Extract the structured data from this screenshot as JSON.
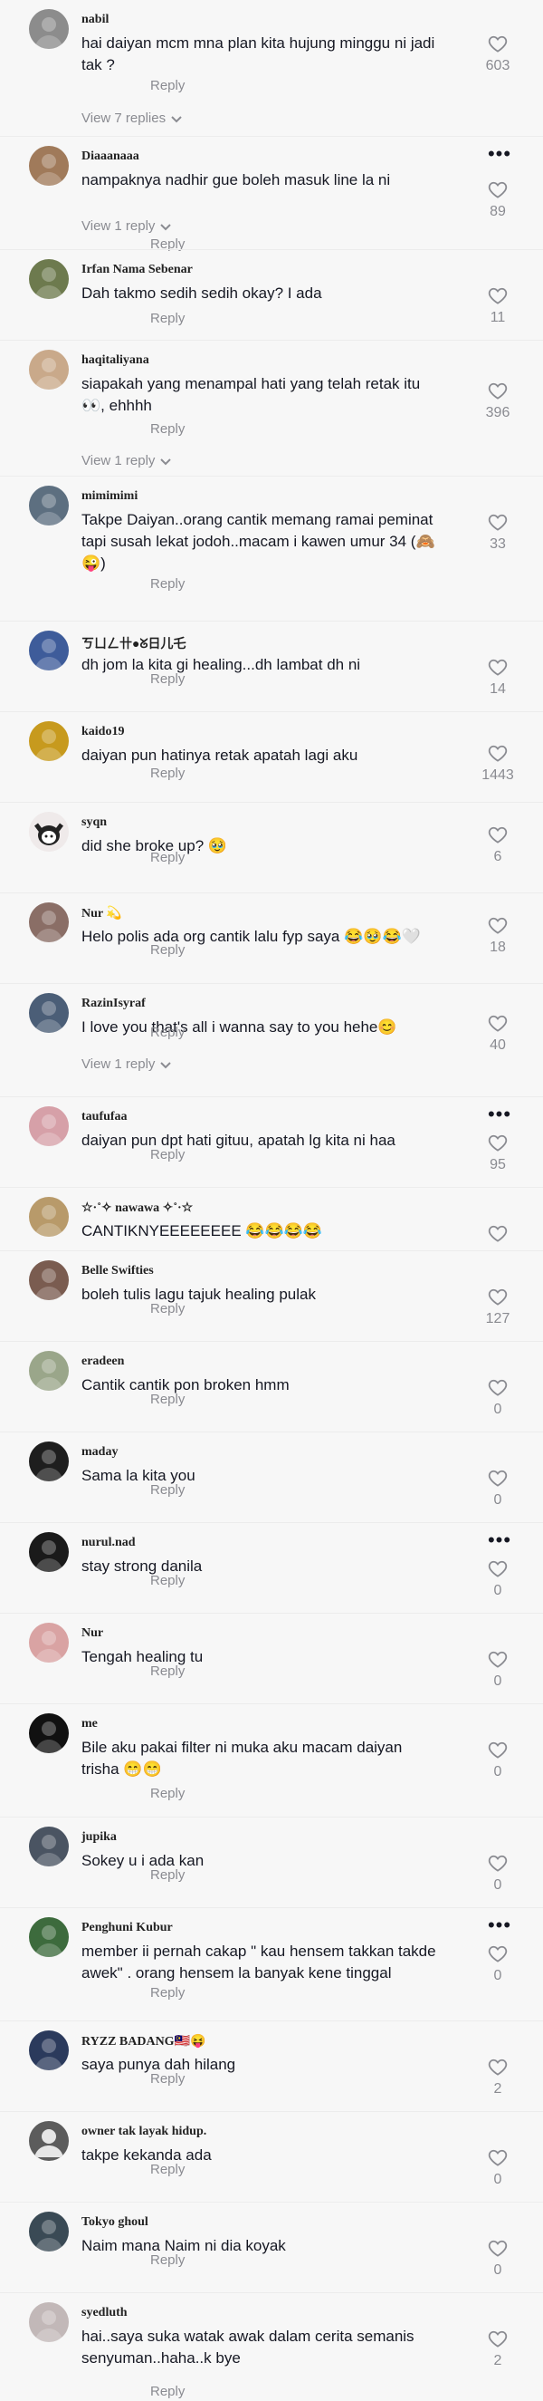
{
  "ui": {
    "reply_label": "Reply",
    "more_glyph": "•••"
  },
  "comments": [
    {
      "username": "nabil",
      "text": "hai daiyan mcm mna plan kita hujung minggu ni jadi tak ?",
      "likes": "603",
      "view_replies": "View 7 replies",
      "more": false,
      "avatar_color": "#8c8c8c",
      "avatar_icon": "profile-photo"
    },
    {
      "username": "Diaaanaaa",
      "text": "nampaknya nadhir gue boleh masuk line la ni",
      "likes": "89",
      "view_replies": "View 1 reply",
      "more": true,
      "avatar_color": "#a07a5a",
      "avatar_icon": "profile-photo"
    },
    {
      "username": "Irfan Nama Sebenar",
      "text": "Dah takmo sedih sedih okay? I ada",
      "likes": "11",
      "view_replies": "",
      "more": false,
      "avatar_color": "#6d7a4e",
      "avatar_icon": "profile-photo"
    },
    {
      "username": "haqitaliyana",
      "text": "siapakah yang menampal hati yang telah retak itu 👀, ehhhh",
      "likes": "396",
      "view_replies": "View 1 reply",
      "more": false,
      "avatar_color": "#c9a98a",
      "avatar_icon": "profile-photo"
    },
    {
      "username": "mimimimi",
      "text": "Takpe Daiyan..orang cantik memang ramai peminat tapi susah lekat jodoh..macam i kawen umur 34 (🙈😜)",
      "likes": "33",
      "view_replies": "",
      "more": false,
      "avatar_color": "#5d6f80",
      "avatar_icon": "profile-photo"
    },
    {
      "username": "ㄎㄩㄥ卄●ᘜ日儿乇",
      "text": "dh jom la kita gi healing...dh lambat dh ni",
      "likes": "14",
      "view_replies": "",
      "more": false,
      "avatar_color": "#3e5c9a",
      "avatar_icon": "profile-photo"
    },
    {
      "username": "kaido19",
      "text": "daiyan pun hatinya retak apatah lagi aku",
      "likes": "1443",
      "view_replies": "",
      "more": false,
      "avatar_color": "#c79a1e",
      "avatar_icon": "profile-photo"
    },
    {
      "username": "syqn",
      "text": "did she broke up? 🥹",
      "likes": "6",
      "view_replies": "",
      "more": false,
      "avatar_color": "#e9e4e4",
      "avatar_icon": "kuromi-avatar"
    },
    {
      "username": "Nur 💫",
      "text": "Helo polis ada org cantik lalu fyp saya 😂🥹😂🤍",
      "likes": "18",
      "view_replies": "",
      "more": false,
      "avatar_color": "#8a6e66",
      "avatar_icon": "profile-photo"
    },
    {
      "username": "RazinIsyraf",
      "text": "I love you that's all i wanna say to you hehe😊",
      "likes": "40",
      "view_replies": "View 1 reply",
      "more": false,
      "avatar_color": "#4b5e77",
      "avatar_icon": "profile-photo"
    },
    {
      "username": "taufufaa",
      "text": "daiyan pun dpt hati gituu, apatah lg kita ni haa",
      "likes": "95",
      "view_replies": "",
      "more": true,
      "avatar_color": "#d6a0a8",
      "avatar_icon": "profile-photo"
    },
    {
      "username": "☆·˚✧ nawawa ✧˚·☆",
      "text": "CANTIKNYEEEEEEEE 😂😂😂😂",
      "likes": "",
      "view_replies": "",
      "more": false,
      "avatar_color": "#b89a6a",
      "avatar_icon": "profile-photo"
    },
    {
      "username": "Belle Swifties",
      "text": "boleh tulis lagu tajuk healing pulak",
      "likes": "127",
      "view_replies": "",
      "more": false,
      "avatar_color": "#7a5c50",
      "avatar_icon": "profile-photo"
    },
    {
      "username": "eradeen",
      "text": "Cantik cantik pon broken hmm",
      "likes": "0",
      "view_replies": "",
      "more": false,
      "avatar_color": "#9aa68a",
      "avatar_icon": "profile-photo"
    },
    {
      "username": "maday",
      "text": "Sama la kita you",
      "likes": "0",
      "view_replies": "",
      "more": false,
      "avatar_color": "#1e1e1e",
      "avatar_icon": "profile-photo"
    },
    {
      "username": "nurul.nad",
      "text": "stay strong danila",
      "likes": "0",
      "view_replies": "",
      "more": true,
      "avatar_color": "#1a1a1a",
      "avatar_icon": "profile-photo"
    },
    {
      "username": "Nur",
      "text": "Tengah healing tu",
      "likes": "0",
      "view_replies": "",
      "more": false,
      "avatar_color": "#d9a3a3",
      "avatar_icon": "profile-photo"
    },
    {
      "username": "me",
      "text": "Bile aku pakai filter ni muka aku macam daiyan trisha 😁😁",
      "likes": "0",
      "view_replies": "",
      "more": false,
      "avatar_color": "#111111",
      "avatar_icon": "profile-photo"
    },
    {
      "username": "jupika",
      "text": "Sokey u i ada kan",
      "likes": "0",
      "view_replies": "",
      "more": false,
      "avatar_color": "#4a5462",
      "avatar_icon": "profile-photo"
    },
    {
      "username": "Penghuni Kubur",
      "text": "member ii pernah cakap \" kau hensem takkan takde awek\" . orang hensem la banyak kene tinggal",
      "likes": "0",
      "view_replies": "",
      "more": true,
      "avatar_color": "#3d6b3d",
      "avatar_icon": "profile-photo"
    },
    {
      "username": "RYZZ BADANG🇲🇾😝",
      "text": "saya punya dah hilang",
      "likes": "2",
      "view_replies": "",
      "more": false,
      "avatar_color": "#2b3a5c",
      "avatar_icon": "profile-photo"
    },
    {
      "username": "owner tak layak hidup.",
      "text": "takpe kekanda ada",
      "likes": "0",
      "view_replies": "",
      "more": false,
      "avatar_color": "#8a8a8a",
      "avatar_icon": "default-avatar"
    },
    {
      "username": "Tokyo ghoul",
      "text": "Naim mana Naim ni dia koyak",
      "likes": "0",
      "view_replies": "",
      "more": false,
      "avatar_color": "#3a4a55",
      "avatar_icon": "profile-photo"
    },
    {
      "username": "syedluth",
      "text": "hai..saya suka watak awak dalam cerita semanis senyuman..haha..k bye",
      "likes": "2",
      "view_replies": "",
      "more": false,
      "avatar_color": "#c2b8b8",
      "avatar_icon": "profile-photo"
    }
  ]
}
